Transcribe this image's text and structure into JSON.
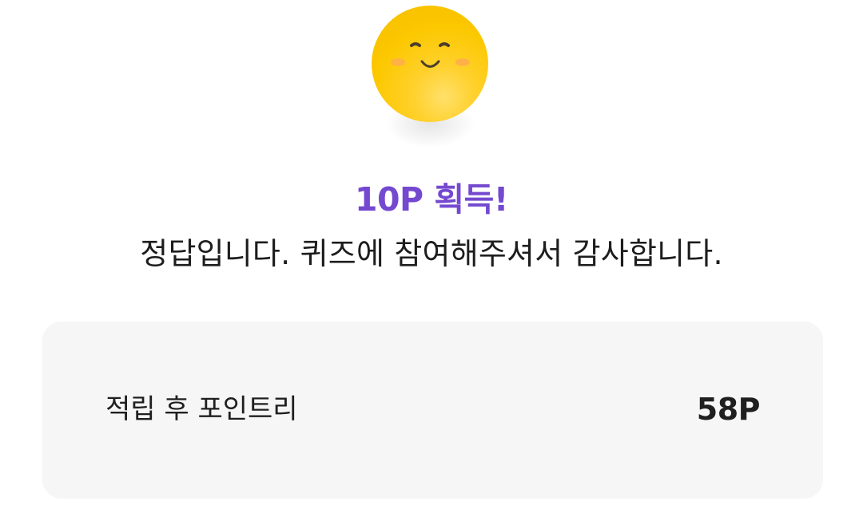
{
  "hero": {
    "icon": "smiling-face-icon"
  },
  "result": {
    "title": "10P 획득!",
    "message": "정답입니다. 퀴즈에 참여해주셔서 감사합니다."
  },
  "points_card": {
    "label": "적립 후 포인트리",
    "value": "58P"
  },
  "colors": {
    "accent": "#7449d0",
    "emoji": "#fcc800",
    "card_background": "#f6f6f6",
    "text": "#1f1f1f"
  }
}
